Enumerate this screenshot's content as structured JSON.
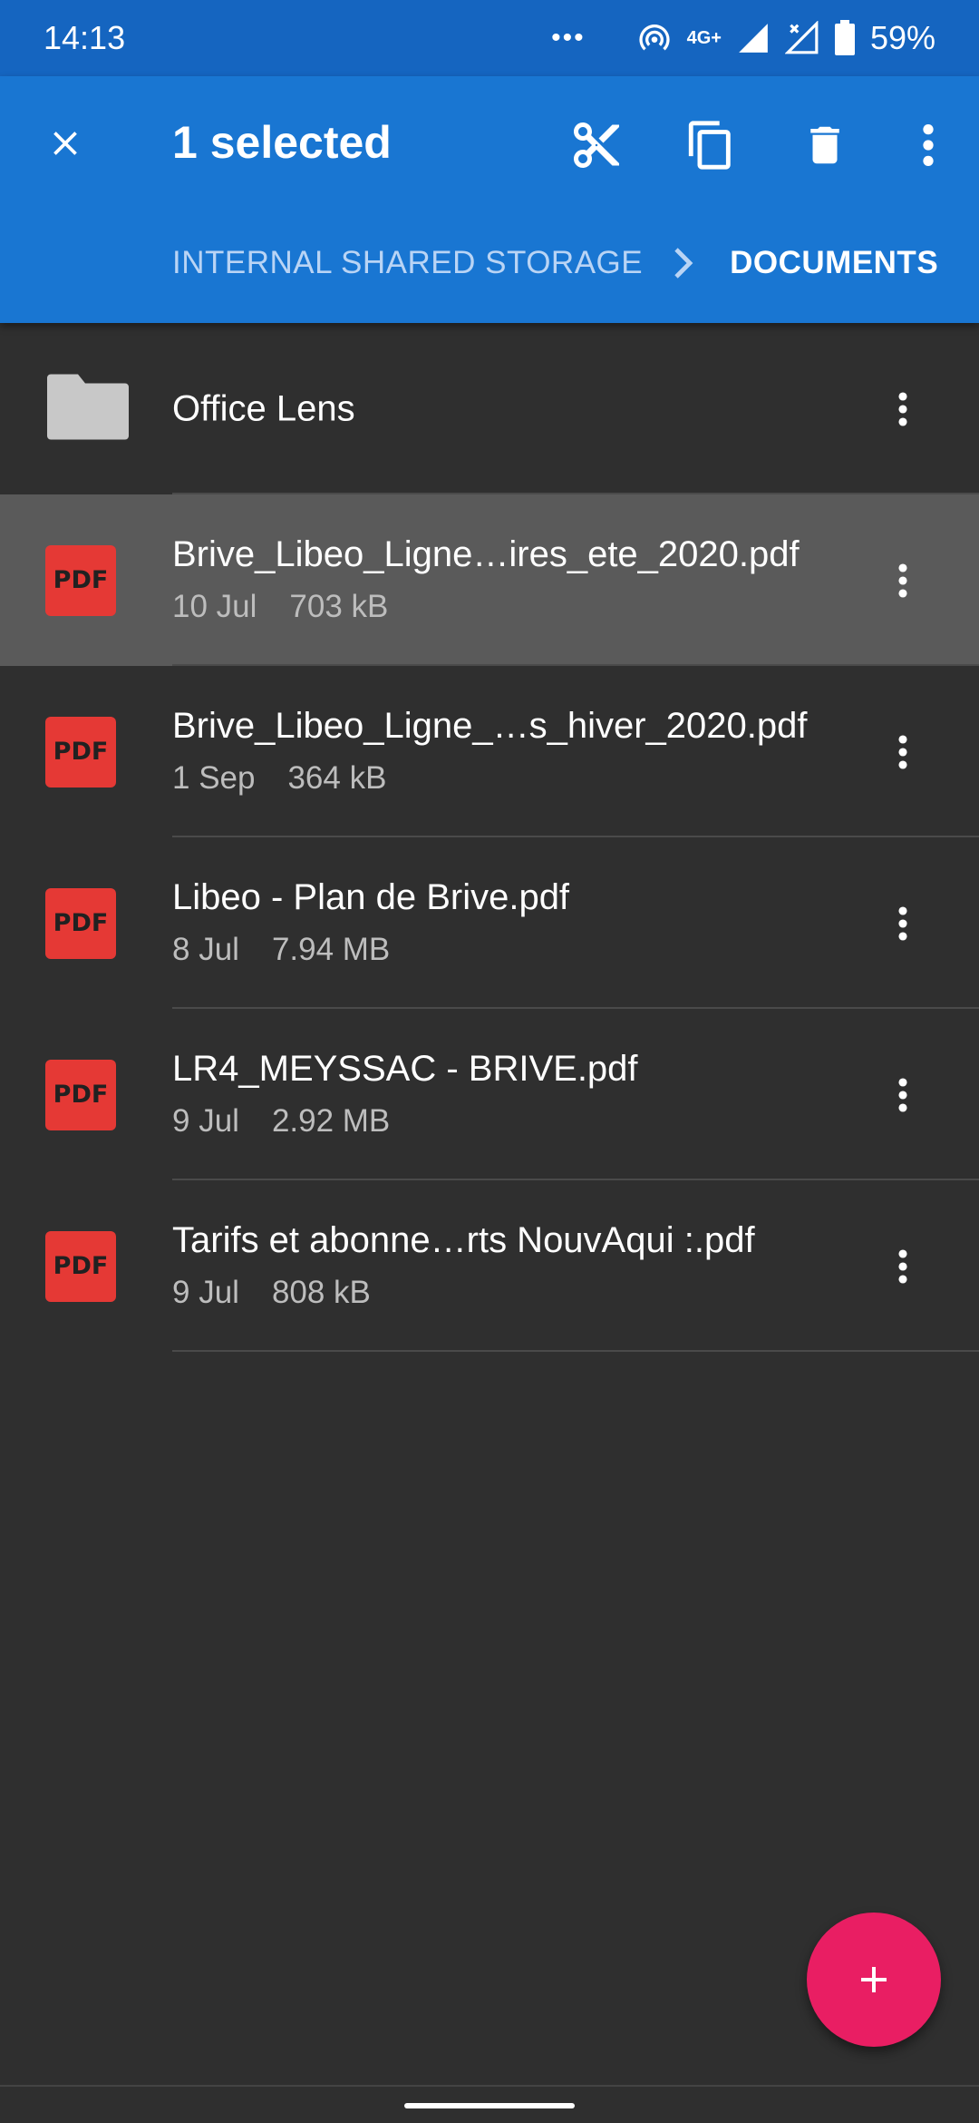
{
  "status_bar": {
    "time": "14:13",
    "overflow": "•••",
    "network": "4G+",
    "battery": "59%",
    "icons": [
      "hotspot-icon",
      "signal-icon",
      "no-signal-icon",
      "battery-icon"
    ]
  },
  "app_bar": {
    "title": "1 selected",
    "icons": [
      "close-icon",
      "cut-icon",
      "copy-icon",
      "delete-icon",
      "more-vert-icon"
    ],
    "breadcrumb": {
      "storage": "INTERNAL SHARED STORAGE",
      "current": "DOCUMENTS"
    }
  },
  "files": [
    {
      "type": "folder",
      "icon": "folder-icon",
      "name": "Office Lens",
      "selected": false
    },
    {
      "type": "pdf",
      "icon_label": "PDF",
      "name": "Brive_Libeo_Ligne…ires_ete_2020.pdf",
      "date": "10 Jul",
      "size": "703 kB",
      "selected": true
    },
    {
      "type": "pdf",
      "icon_label": "PDF",
      "name": "Brive_Libeo_Ligne_…s_hiver_2020.pdf",
      "date": "1 Sep",
      "size": "364 kB",
      "selected": false
    },
    {
      "type": "pdf",
      "icon_label": "PDF",
      "name": "Libeo - Plan de Brive.pdf",
      "date": "8 Jul",
      "size": "7.94 MB",
      "selected": false
    },
    {
      "type": "pdf",
      "icon_label": "PDF",
      "name": "LR4_MEYSSAC - BRIVE.pdf",
      "date": "9 Jul",
      "size": "2.92 MB",
      "selected": false
    },
    {
      "type": "pdf",
      "icon_label": "PDF",
      "name": "Tarifs et abonne…rts NouvAqui :.pdf",
      "date": "9 Jul",
      "size": "808 kB",
      "selected": false
    }
  ],
  "fab": {
    "icon": "plus-icon"
  },
  "colors": {
    "status_bar": "#1565c0",
    "app_bar": "#1976d2",
    "background": "#2f2f2f",
    "selected_row": "#5a5a5a",
    "pdf_red": "#e53935",
    "fab_pink": "#e91e63"
  }
}
